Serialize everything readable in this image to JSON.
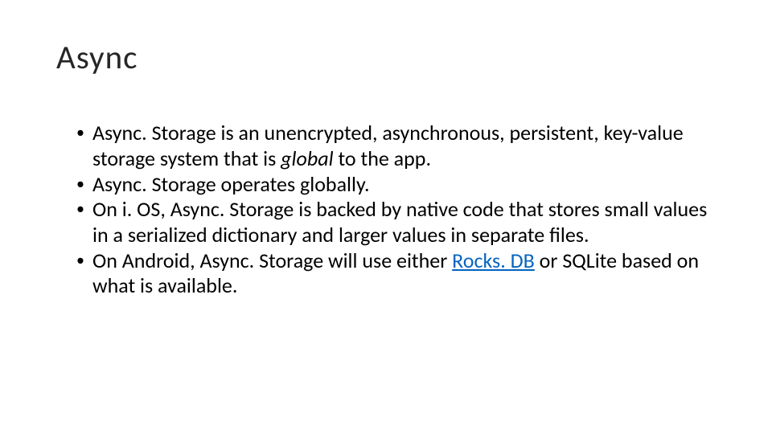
{
  "title": "Async",
  "bullets": [
    {
      "pre": "Async. Storage is an unencrypted, asynchronous, persistent, key-value storage system that is ",
      "italic": "global",
      "post": " to the app."
    },
    {
      "pre": "Async. Storage operates globally.",
      "italic": "",
      "post": ""
    },
    {
      "pre": "On i. OS, Async. Storage is backed by native code that stores small values in a serialized dictionary and larger values in separate files.",
      "italic": "",
      "post": ""
    },
    {
      "pre": "On Android, Async. Storage will use either ",
      "link": "Rocks. DB",
      "post2": " or SQLite based on what is available."
    }
  ]
}
